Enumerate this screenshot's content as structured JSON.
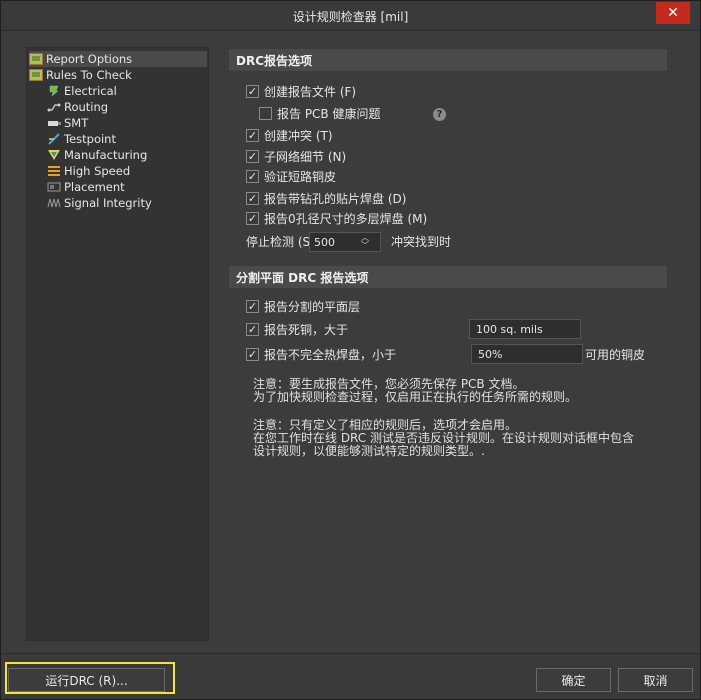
{
  "window": {
    "title": "设计规则检查器 [mil]",
    "close_glyph": "✕"
  },
  "tree": {
    "items": [
      {
        "label": "Report Options",
        "icon": "report-folder-icon"
      },
      {
        "label": "Rules To Check",
        "icon": "rules-folder-icon"
      },
      {
        "label": "Electrical",
        "icon": "electrical-icon"
      },
      {
        "label": "Routing",
        "icon": "routing-icon"
      },
      {
        "label": "SMT",
        "icon": "smt-icon"
      },
      {
        "label": "Testpoint",
        "icon": "testpoint-icon"
      },
      {
        "label": "Manufacturing",
        "icon": "manufacturing-icon"
      },
      {
        "label": "High Speed",
        "icon": "high-speed-icon"
      },
      {
        "label": "Placement",
        "icon": "placement-icon"
      },
      {
        "label": "Signal Integrity",
        "icon": "signal-integrity-icon"
      }
    ]
  },
  "drc_section": {
    "header": "DRC报告选项",
    "options": [
      {
        "label": "创建报告文件 (F)",
        "checked": true
      },
      {
        "label": "报告 PCB 健康问题",
        "checked": false
      },
      {
        "label": "创建冲突 (T)",
        "checked": true
      },
      {
        "label": "子网络细节 (N)",
        "checked": true
      },
      {
        "label": "验证短路铜皮",
        "checked": true
      },
      {
        "label": "报告带钻孔的贴片焊盘 (D)",
        "checked": true
      },
      {
        "label": "报告0孔径尺寸的多层焊盘 (M)",
        "checked": true
      }
    ],
    "stop_label": "停止检测 (S",
    "stop_value": "500",
    "stop_suffix": "冲突找到时"
  },
  "split_section": {
    "header": "分割平面 DRC 报告选项",
    "options": [
      {
        "label": "报告分割的平面层",
        "checked": true
      },
      {
        "label": "报告死铜，大于",
        "checked": true,
        "value": "100 sq. mils"
      },
      {
        "label": "报告不完全热焊盘，小于",
        "checked": true,
        "value": "50%",
        "suffix": "可用的铜皮"
      }
    ]
  },
  "notes": {
    "note1_line1": "注意：要生成报告文件，您必须先保存 PCB 文档。",
    "note1_line2": "为了加快规则检查过程，仅启用正在执行的任务所需的规则。",
    "note2_line1": "注意：只有定义了相应的规则后，选项才会启用。",
    "note2_line2": "在您工作时在线 DRC 测试是否违反设计规则。在设计规则对话框中包含",
    "note2_line3": "设计规则，以便能够测试特定的规则类型。."
  },
  "buttons": {
    "run": "运行DRC (R)...",
    "ok": "确定",
    "cancel": "取消"
  },
  "colors": {
    "highlight": "#f2e53a",
    "close": "#c42b1c"
  }
}
